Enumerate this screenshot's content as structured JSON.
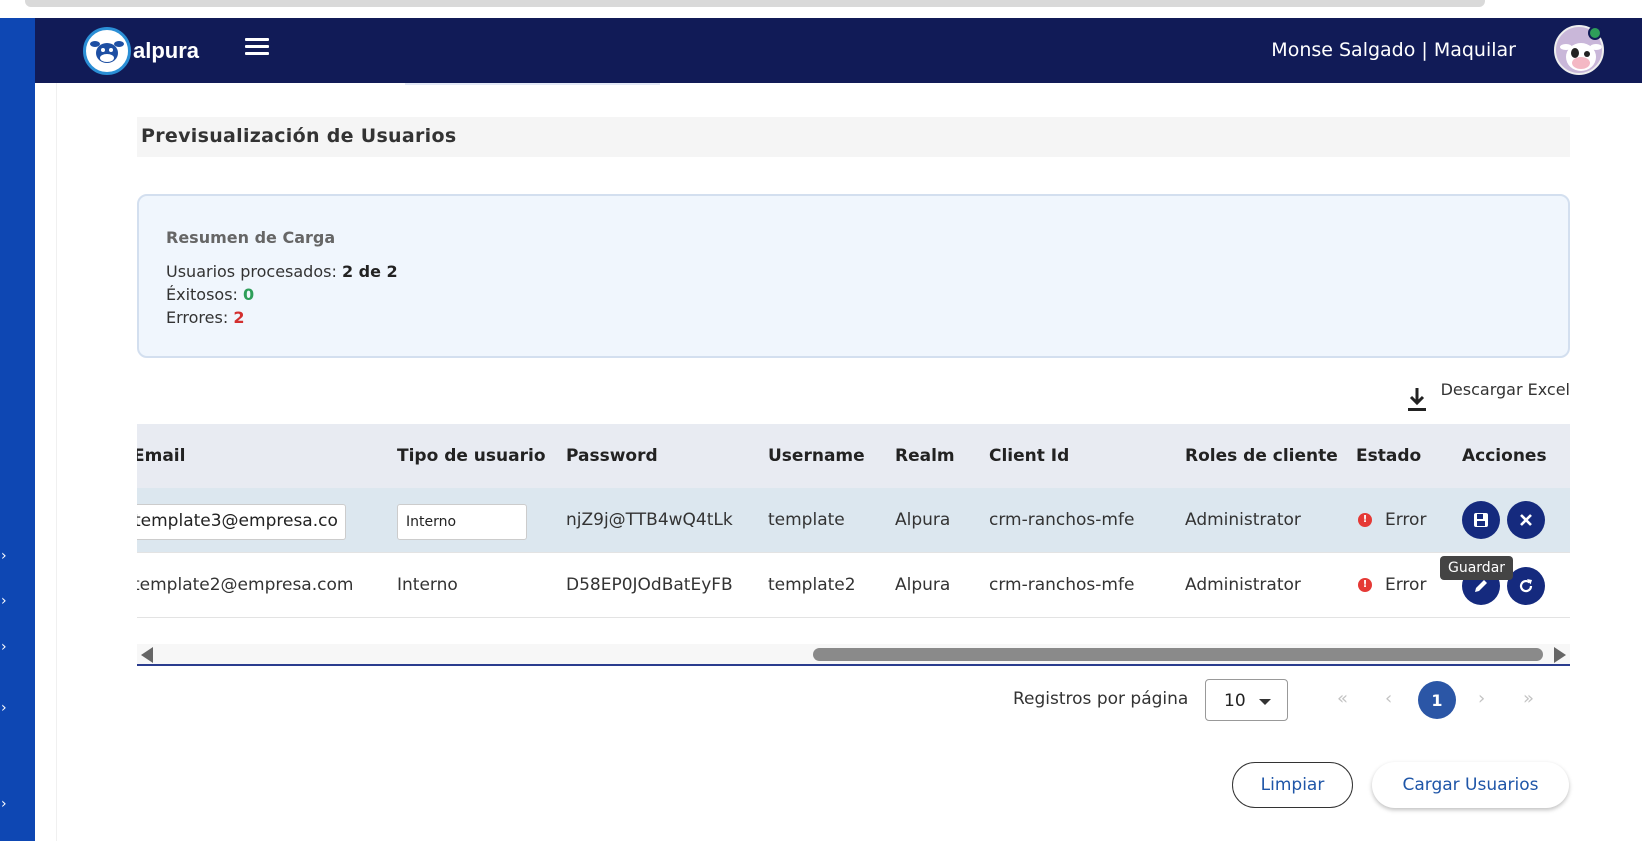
{
  "header": {
    "logo_text": "alpura",
    "user_label": "Monse Salgado | Maquilar",
    "colors": {
      "topbar": "#111b57",
      "side_rail": "#0e47b3"
    }
  },
  "page": {
    "title": "Previsualización de Usuarios"
  },
  "summary": {
    "title": "Resumen de Carga",
    "processed_label": "Usuarios procesados:",
    "processed_value": "2 de 2",
    "success_label": "Éxitosos:",
    "success_value": "0",
    "errors_label": "Errores:",
    "errors_value": "2"
  },
  "download": {
    "label": "Descargar Excel",
    "icon": "download-icon"
  },
  "table": {
    "columns": [
      "Email",
      "Tipo de usuario",
      "Password",
      "Username",
      "Realm",
      "Client Id",
      "Roles de cliente",
      "Estado",
      "Acciones"
    ],
    "rows": [
      {
        "email": "template3@empresa.co",
        "tipo": "Interno",
        "password": "njZ9j@TTB4wQ4tLk",
        "username": "template",
        "realm": "Alpura",
        "client_id": "crm-ranchos-mfe",
        "roles": "Administrator",
        "estado": "Error",
        "editing": true
      },
      {
        "email": "template2@empresa.com",
        "tipo": "Interno",
        "password": "D58EP0JOdBatEyFB",
        "username": "template2",
        "realm": "Alpura",
        "client_id": "crm-ranchos-mfe",
        "roles": "Administrator",
        "estado": "Error",
        "editing": false
      }
    ],
    "tooltip": "Guardar"
  },
  "pagination": {
    "label": "Registros por página",
    "page_size": "10",
    "current_page": "1"
  },
  "actions": {
    "clear_label": "Limpiar",
    "load_label": "Cargar Usuarios"
  }
}
